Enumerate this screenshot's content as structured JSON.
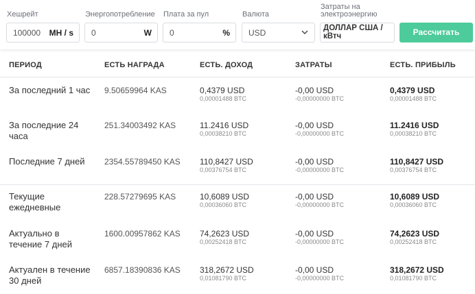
{
  "inputs": {
    "hashrate": {
      "label": "Хешрейт",
      "value": "100000",
      "unit": "MH / s"
    },
    "power": {
      "label": "Энергопотребление",
      "value": "0",
      "unit": "W"
    },
    "pool_fee": {
      "label": "Плата за пул",
      "value": "0",
      "unit": "%"
    },
    "currency": {
      "label": "Валюта",
      "value": "USD"
    },
    "electricity": {
      "label": "Затраты на электроэнергию",
      "value": "ДОЛЛАР США / кВтч"
    },
    "calculate_label": "Рассчитать"
  },
  "table": {
    "headers": [
      "ПЕРИОД",
      "ЕСТЬ НАГРАДА",
      "ЕСТЬ. ДОХОД",
      "ЗАТРАТЫ",
      "ЕСТЬ. ПРИБЫЛЬ"
    ],
    "rows": [
      {
        "period": "За последний 1 час",
        "reward": "9.50659964 KAS",
        "income": "0,4379 USD",
        "income_btc": "0,00001488 BTC",
        "cost": "-0,00 USD",
        "cost_btc": "-0,00000000 BTC",
        "profit": "0,4379 USD",
        "profit_btc": "0,00001488 BTC"
      },
      {
        "period": "За последние 24 часа",
        "reward": "251.34003492 KAS",
        "income": "11.2416 USD",
        "income_btc": "0,00038210 BTC",
        "cost": "-0,00 USD",
        "cost_btc": "-0,00000000 BTC",
        "profit": "11.2416 USD",
        "profit_btc": "0,00038210 BTC"
      },
      {
        "period": "Последние 7 дней",
        "reward": "2354.55789450 KAS",
        "income": "110,8427 USD",
        "income_btc": "0,00376754 BTC",
        "cost": "-0,00 USD",
        "cost_btc": "-0,00000000 BTC",
        "profit": "110,8427 USD",
        "profit_btc": "0,00376754 BTC"
      },
      {
        "period": "Текущие ежедневные",
        "reward": "228.57279695 KAS",
        "income": "10,6089 USD",
        "income_btc": "0,00036060 BTC",
        "cost": "-0,00 USD",
        "cost_btc": "-0,00000000 BTC",
        "profit": "10,6089 USD",
        "profit_btc": "0,00036060 BTC"
      },
      {
        "period": "Актуально в течение 7 дней",
        "reward": "1600.00957862 KAS",
        "income": "74,2623 USD",
        "income_btc": "0,00252418 BTC",
        "cost": "-0,00 USD",
        "cost_btc": "-0,00000000 BTC",
        "profit": "74,2623 USD",
        "profit_btc": "0,00252418 BTC"
      },
      {
        "period": "Актуален в течение 30 дней",
        "reward": "6857.18390836 KAS",
        "income": "318,2672 USD",
        "income_btc": "0,01081790 BTC",
        "cost": "-0,00 USD",
        "cost_btc": "-0,00000000 BTC",
        "profit": "318,2672 USD",
        "profit_btc": "0,01081790 BTC"
      }
    ]
  }
}
